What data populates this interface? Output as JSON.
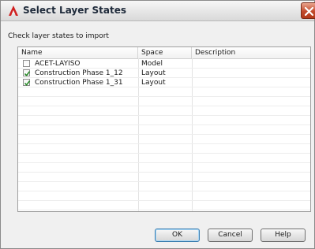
{
  "window": {
    "title": "Select Layer States"
  },
  "instruction": "Check layer states to import",
  "table": {
    "columns": [
      "Name",
      "Space",
      "Description"
    ],
    "rows": [
      {
        "name": "ACET-LAYISO",
        "space": "Model",
        "description": "",
        "checked": false
      },
      {
        "name": "Construction Phase 1_12",
        "space": "Layout",
        "description": "",
        "checked": true
      },
      {
        "name": "Construction Phase 1_31",
        "space": "Layout",
        "description": "",
        "checked": true
      }
    ]
  },
  "buttons": {
    "ok": "OK",
    "cancel": "Cancel",
    "help": "Help"
  },
  "colors": {
    "check": "#2a8a2a",
    "close_button": "#c24a2c"
  },
  "icons": {
    "app": "autocad-a-icon",
    "close": "close-x-icon",
    "check": "checkmark-icon"
  }
}
